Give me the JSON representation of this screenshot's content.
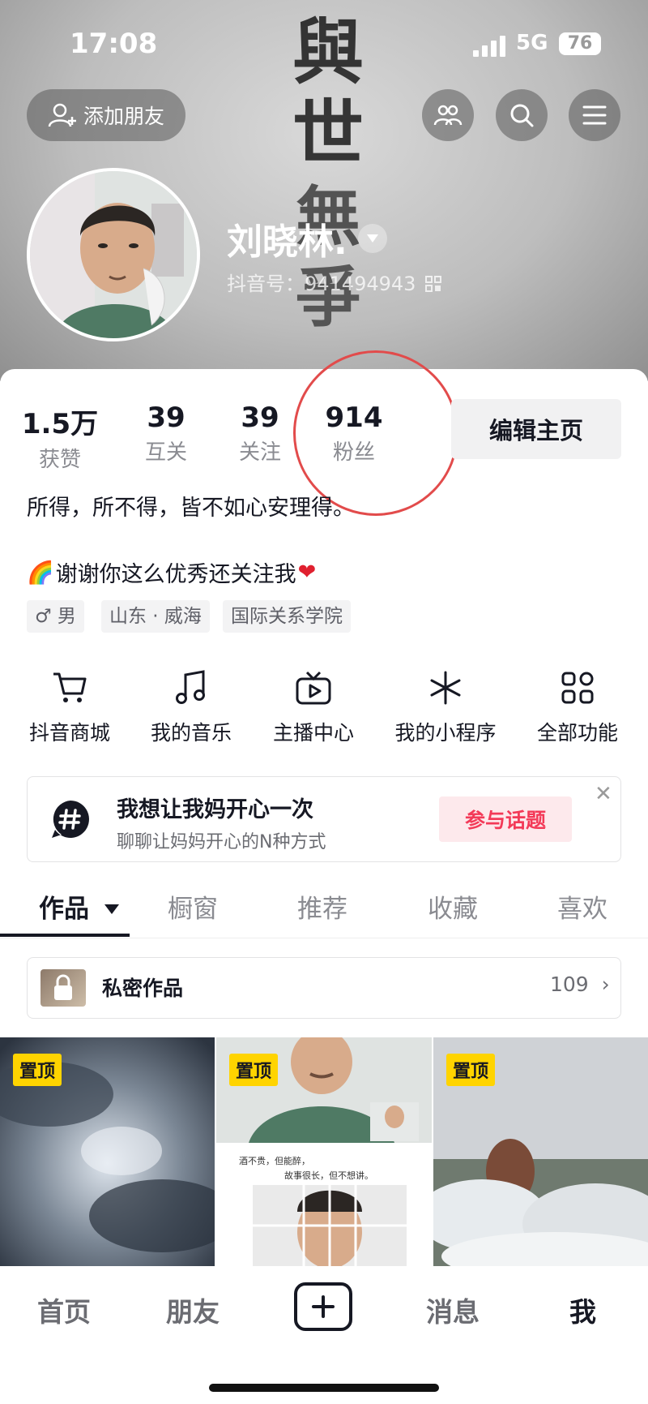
{
  "status_bar": {
    "time": "17:08",
    "network": "5G",
    "battery": "76"
  },
  "header": {
    "add_friend_label": "添加朋友",
    "nickname": "刘晓林.",
    "douyin_id": "抖音号：941494943",
    "calligraphy": "與世無爭"
  },
  "stats": [
    {
      "value": "1.5万",
      "label": "获赞"
    },
    {
      "value": "39",
      "label": "互关"
    },
    {
      "value": "39",
      "label": "关注"
    },
    {
      "value": "914",
      "label": "粉丝"
    }
  ],
  "edit_profile_label": "编辑主页",
  "bio": {
    "line1": "所得，所不得，皆不如心安理得。",
    "line2_emoji_prefix": "🌈",
    "line2_text": "谢谢你这么优秀还关注我",
    "line2_emoji_suffix": "❤"
  },
  "tags": [
    {
      "icon": "male-icon",
      "text": "♂ 男"
    },
    {
      "text": "山东 · 威海"
    },
    {
      "text": "国际关系学院"
    }
  ],
  "functions": [
    {
      "icon": "cart-icon",
      "label": "抖音商城"
    },
    {
      "icon": "music-icon",
      "label": "我的音乐"
    },
    {
      "icon": "tv-icon",
      "label": "主播中心"
    },
    {
      "icon": "asterisk-icon",
      "label": "我的小程序"
    },
    {
      "icon": "grid-icon",
      "label": "全部功能"
    }
  ],
  "topic": {
    "title": "我想让我妈开心一次",
    "subtitle": "聊聊让妈妈开心的N种方式",
    "join_label": "参与话题",
    "close_glyph": "✕"
  },
  "tabs": [
    "作品",
    "橱窗",
    "推荐",
    "收藏",
    "喜欢"
  ],
  "private_works": {
    "label": "私密作品",
    "count": "109",
    "arrow": "›"
  },
  "grid": [
    {
      "pin": "置顶",
      "kind": "sky"
    },
    {
      "pin": "置顶",
      "kind": "person",
      "caption1": "酒不贵，但能醉，",
      "caption2": "故事很长，但不想讲。"
    },
    {
      "pin": "置顶",
      "kind": "snow"
    }
  ],
  "bottom_nav": [
    "首页",
    "朋友",
    "消息",
    "我"
  ],
  "colors": {
    "accent": "#f33a58",
    "pin": "#ffd400",
    "annotation": "#e24b4b"
  }
}
